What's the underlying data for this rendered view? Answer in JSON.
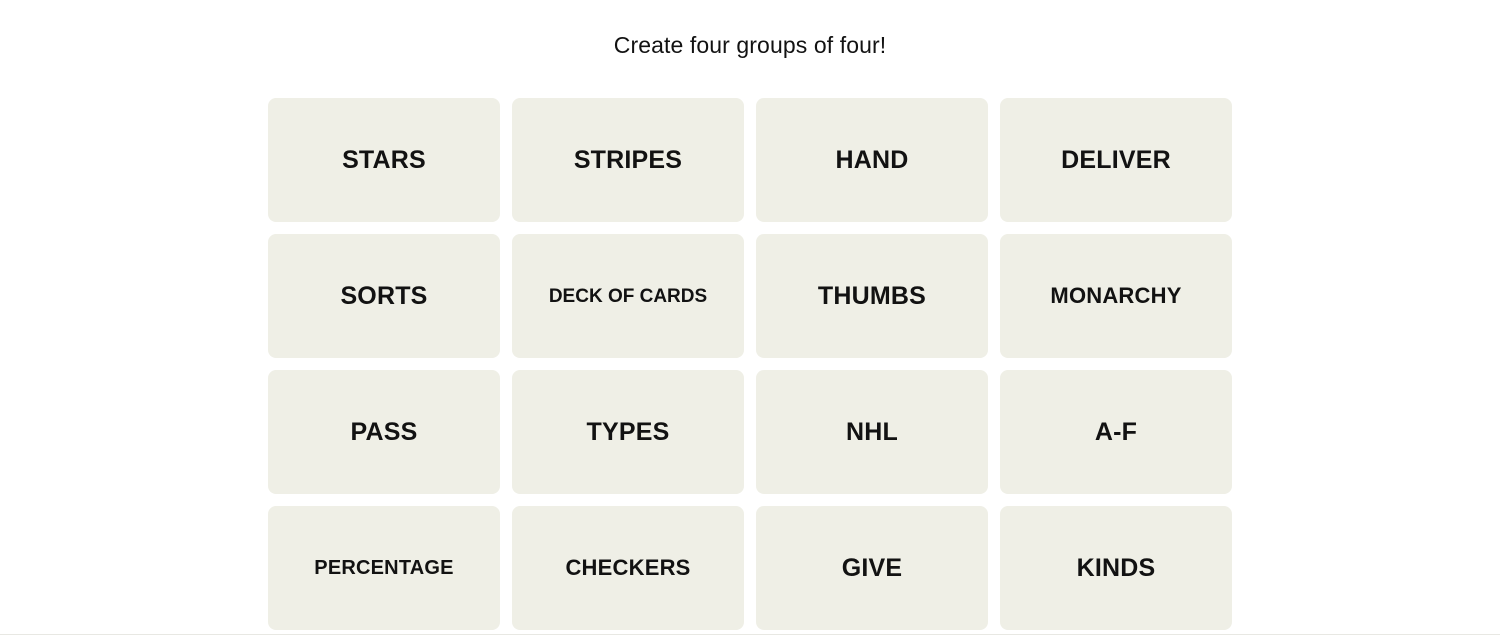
{
  "game": {
    "instruction": "Create four groups of four!",
    "colors": {
      "page_background": "#FFFFFF",
      "tile_background": "#EFEFE6",
      "tile_text": "#121212",
      "divider": "#E8E8E3"
    },
    "grid": {
      "rows": 4,
      "columns": 4
    },
    "tiles": [
      {
        "label": "STARS"
      },
      {
        "label": "STRIPES"
      },
      {
        "label": "HAND"
      },
      {
        "label": "DELIVER"
      },
      {
        "label": "SORTS"
      },
      {
        "label": "DECK OF CARDS"
      },
      {
        "label": "THUMBS"
      },
      {
        "label": "MONARCHY"
      },
      {
        "label": "PASS"
      },
      {
        "label": "TYPES"
      },
      {
        "label": "NHL"
      },
      {
        "label": "A-F"
      },
      {
        "label": "PERCENTAGE"
      },
      {
        "label": "CHECKERS"
      },
      {
        "label": "GIVE"
      },
      {
        "label": "KINDS"
      }
    ]
  }
}
